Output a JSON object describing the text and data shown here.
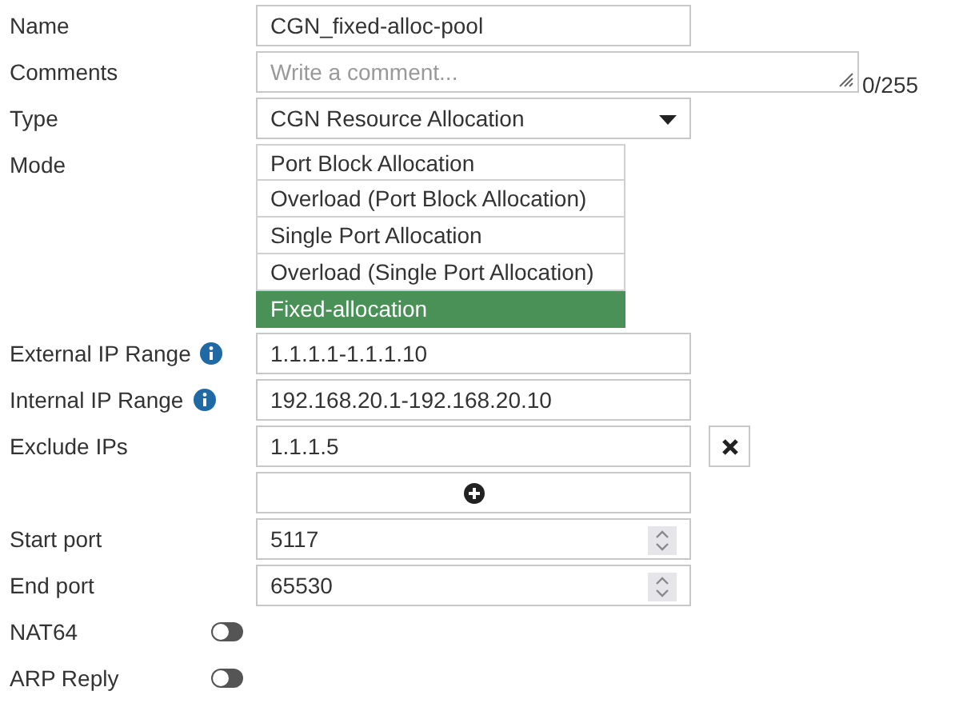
{
  "fields": [
    {
      "kind": "text",
      "label": "Name",
      "value": "CGN_fixed-alloc-pool"
    },
    {
      "kind": "textarea",
      "label": "Comments",
      "placeholder": "Write a comment...",
      "counter": "0/255"
    },
    {
      "kind": "select",
      "label": "Type",
      "value": "CGN Resource Allocation"
    },
    {
      "kind": "options",
      "label": "Mode",
      "options": [
        {
          "label": "Port Block Allocation",
          "selected": false
        },
        {
          "label": "Overload (Port Block Allocation)",
          "selected": false
        },
        {
          "label": "Single Port Allocation",
          "selected": false
        },
        {
          "label": "Overload (Single Port Allocation)",
          "selected": false
        },
        {
          "label": "Fixed-allocation",
          "selected": true
        }
      ]
    },
    {
      "kind": "text",
      "label": "External IP Range",
      "info": true,
      "value": "1.1.1.1-1.1.1.10"
    },
    {
      "kind": "text",
      "label": "Internal IP Range",
      "info": true,
      "value": "192.168.20.1-192.168.20.10"
    },
    {
      "kind": "list",
      "label": "Exclude IPs",
      "entries": [
        "1.1.1.5"
      ]
    },
    {
      "kind": "number",
      "label": "Start port",
      "value": "5117"
    },
    {
      "kind": "number",
      "label": "End port",
      "value": "65530"
    },
    {
      "kind": "toggle",
      "label": "NAT64",
      "on": false
    },
    {
      "kind": "toggle",
      "label": "ARP Reply",
      "on": false
    }
  ]
}
